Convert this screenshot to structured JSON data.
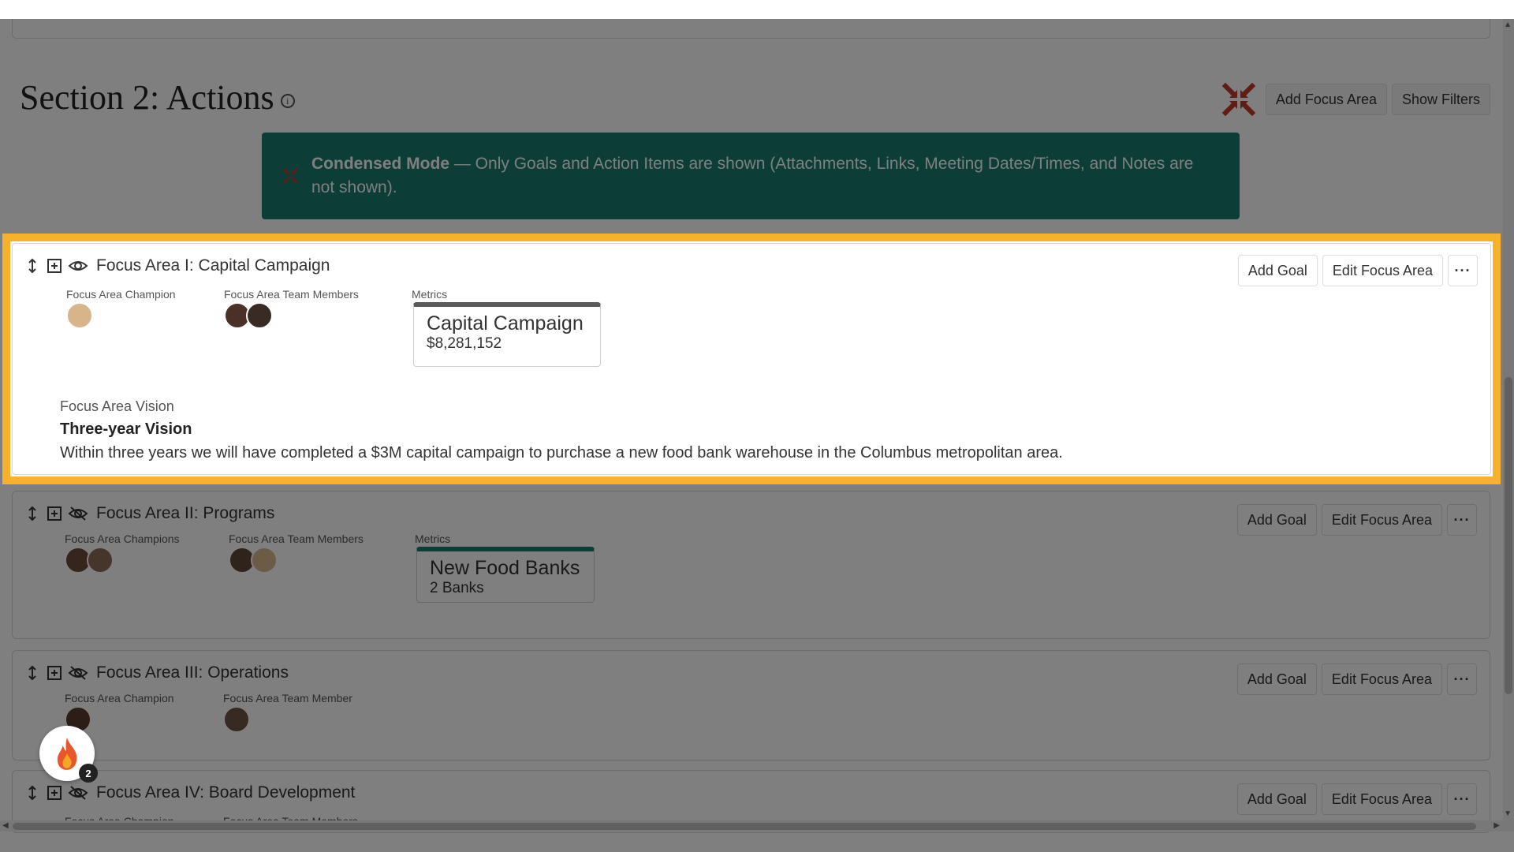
{
  "section": {
    "title": "Section 2: Actions",
    "add_focus_area": "Add Focus Area",
    "show_filters": "Show Filters"
  },
  "banner": {
    "bold": "Condensed Mode",
    "text": " — Only Goals and Action Items are shown (Attachments, Links, Meeting Dates/Times, and Notes are not shown)."
  },
  "buttons": {
    "add_goal": "Add Goal",
    "edit_focus_area": "Edit Focus Area",
    "more": "···"
  },
  "focus_areas": [
    {
      "title": "Focus Area I: Capital Campaign",
      "champion_label": "Focus Area Champion",
      "team_label": "Focus Area Team Members",
      "metrics_label": "Metrics",
      "metric_name": "Capital Campaign",
      "metric_value": "$8,281,152",
      "metric_color": "#5a5a5a",
      "vision_label": "Focus Area Vision",
      "vision_title": "Three-year Vision",
      "vision_text": "Within three years we will have completed a $3M capital campaign to purchase a new food bank warehouse in the Columbus metropolitan area."
    },
    {
      "title": "Focus Area II: Programs",
      "champion_label": "Focus Area Champions",
      "team_label": "Focus Area Team Members",
      "metrics_label": "Metrics",
      "metric_name": "New Food Banks",
      "metric_value": "2 Banks",
      "metric_color": "#1a7a6e"
    },
    {
      "title": "Focus Area III: Operations",
      "champion_label": "Focus Area Champion",
      "team_label": "Focus Area Team Member"
    },
    {
      "title": "Focus Area IV: Board Development",
      "champion_label": "Focus Area Champion",
      "team_label": "Focus Area Team Members"
    }
  ],
  "notifications": {
    "count": "2"
  },
  "colors": {
    "highlight": "#f5b22a",
    "banner": "#1a7a6e",
    "condense_icon": "#c0392b"
  }
}
